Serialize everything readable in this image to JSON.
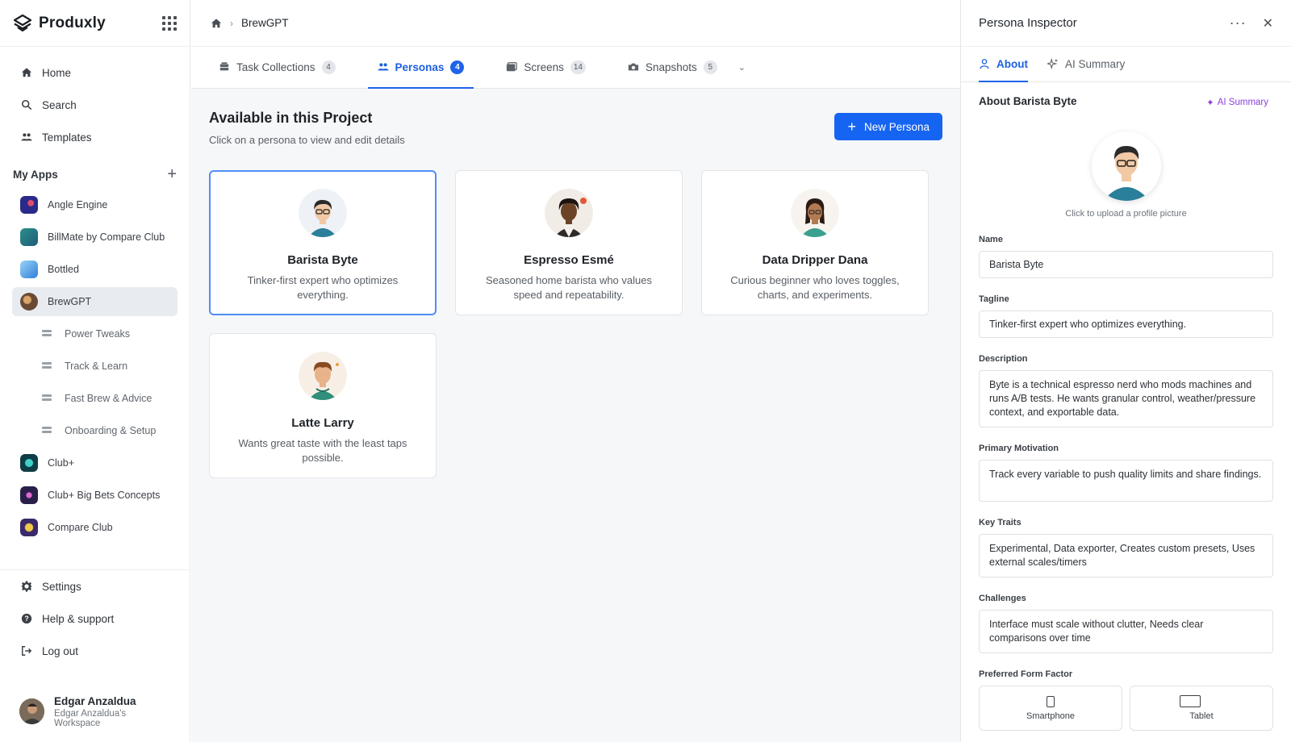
{
  "brand": {
    "name": "Produxly"
  },
  "nav": [
    {
      "label": "Home",
      "icon": "home-icon"
    },
    {
      "label": "Search",
      "icon": "search-icon"
    },
    {
      "label": "Templates",
      "icon": "users-icon"
    }
  ],
  "my_apps": {
    "title": "My Apps",
    "apps": [
      {
        "label": "Angle Engine",
        "color": "#2a2a8a"
      },
      {
        "label": "BillMate by Compare Club",
        "color": "#2b8f8a"
      },
      {
        "label": "Bottled",
        "color": "#3fa0e8"
      },
      {
        "label": "BrewGPT",
        "color": "#6b4a33",
        "active": true
      }
    ],
    "sub_items": [
      "Power Tweaks",
      "Track & Learn",
      "Fast Brew & Advice",
      "Onboarding & Setup"
    ],
    "more_apps": [
      {
        "label": "Club+",
        "color": "#0f3d45"
      },
      {
        "label": "Club+ Big Bets Concepts",
        "color": "#2a1f4a"
      },
      {
        "label": "Compare Club",
        "color": "#3a2a6a"
      }
    ]
  },
  "bottom_nav": [
    {
      "label": "Settings",
      "icon": "gear-icon"
    },
    {
      "label": "Help & support",
      "icon": "help-icon"
    },
    {
      "label": "Log out",
      "icon": "logout-icon"
    }
  ],
  "user": {
    "name": "Edgar Anzaldua",
    "workspace": "Edgar Anzaldua's Workspace"
  },
  "breadcrumb": {
    "current": "BrewGPT"
  },
  "tabs": [
    {
      "label": "Task Collections",
      "count": "4"
    },
    {
      "label": "Personas",
      "count": "4",
      "active": true
    },
    {
      "label": "Screens",
      "count": "14"
    },
    {
      "label": "Snapshots",
      "count": "5"
    }
  ],
  "content": {
    "title": "Available in this Project",
    "subtitle": "Click on a persona to view and edit details",
    "new_button": "New Persona"
  },
  "personas": [
    {
      "name": "Barista Byte",
      "desc": "Tinker-first expert who optimizes everything.",
      "selected": true,
      "skin": "#f1c9a5",
      "hair": "#2a2a2a",
      "shirt": "#2a7f9a"
    },
    {
      "name": "Espresso Esmé",
      "desc": "Seasoned home barista who values speed and repeatability.",
      "skin": "#6b4428",
      "hair": "#1c1410",
      "shirt": "#2e2a28"
    },
    {
      "name": "Data Dripper Dana",
      "desc": "Curious beginner who loves toggles, charts, and experiments.",
      "skin": "#b27a52",
      "hair": "#2a1a12",
      "shirt": "#3aa08f"
    },
    {
      "name": "Latte Larry",
      "desc": "Wants great taste with the least taps possible.",
      "skin": "#e8b38b",
      "hair": "#8a4a22",
      "shirt": "#2f8f7a"
    }
  ],
  "inspector": {
    "title": "Persona Inspector",
    "tabs": [
      "About",
      "AI Summary"
    ],
    "about_title": "About Barista Byte",
    "ai_link": "AI Summary",
    "upload_hint": "Click to upload a profile picture",
    "fields": {
      "name_label": "Name",
      "name_value": "Barista Byte",
      "tagline_label": "Tagline",
      "tagline_value": "Tinker-first expert who optimizes everything.",
      "description_label": "Description",
      "description_value": "Byte is a technical espresso nerd who mods machines and runs A/B tests. He wants granular control, weather/pressure context, and exportable data.",
      "motivation_label": "Primary Motivation",
      "motivation_value": "Track every variable to push quality limits and share findings.",
      "traits_label": "Key Traits",
      "traits_value": "Experimental, Data exporter, Creates custom presets, Uses external scales/timers",
      "challenges_label": "Challenges",
      "challenges_value": "Interface must scale without clutter, Needs clear comparisons over time",
      "form_factor_label": "Preferred Form Factor",
      "form_factors": [
        "Smartphone",
        "Tablet"
      ]
    }
  },
  "colors": {
    "accent": "#1f63ea",
    "ai_purple": "#8b3fd9"
  }
}
